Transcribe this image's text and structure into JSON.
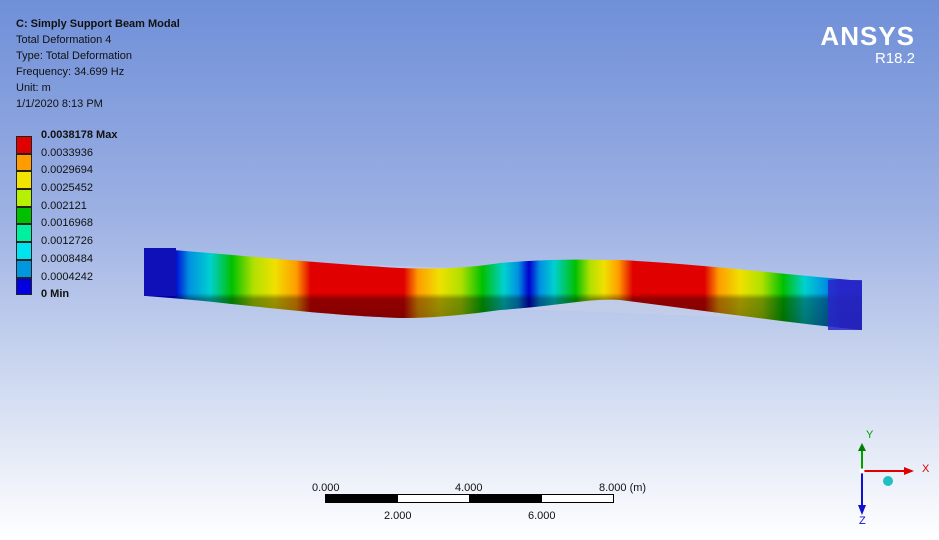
{
  "info": {
    "title": "C: Simply Support Beam Modal",
    "lines": [
      "Total Deformation 4",
      "Type: Total Deformation",
      "Frequency: 34.699 Hz",
      "Unit: m",
      "1/1/2020 8:13 PM"
    ]
  },
  "brand": {
    "name": "ANSYS",
    "version": "R18.2"
  },
  "legend": {
    "colors": [
      "#e00000",
      "#ff9c00",
      "#f2e400",
      "#b4f000",
      "#00c000",
      "#00f0a0",
      "#00e4f0",
      "#0096e0",
      "#0000e0"
    ],
    "labels": [
      "0.0038178 Max",
      "0.0033936",
      "0.0029694",
      "0.0025452",
      "0.002121",
      "0.0016968",
      "0.0012726",
      "0.0008484",
      "0.0004242",
      "0 Min"
    ]
  },
  "scale": {
    "top_labels": [
      "0.000",
      "4.000",
      "8.000 (m)"
    ],
    "bottom_labels": [
      "2.000",
      "6.000"
    ]
  },
  "triad": {
    "x": "X",
    "y": "Y",
    "z": "Z"
  }
}
